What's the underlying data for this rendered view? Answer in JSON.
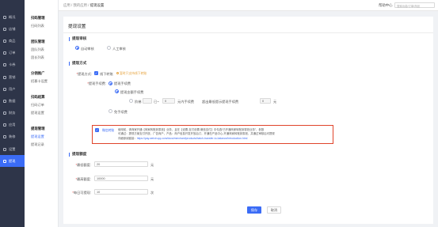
{
  "sidebar": {
    "items": [
      {
        "label": "概况"
      },
      {
        "label": "店铺"
      },
      {
        "label": "商品"
      },
      {
        "label": "订单"
      },
      {
        "label": "卡券"
      },
      {
        "label": "营销"
      },
      {
        "label": "用户"
      },
      {
        "label": "数据"
      },
      {
        "label": "财务"
      },
      {
        "label": "应用"
      },
      {
        "label": "装修"
      },
      {
        "label": "设置"
      },
      {
        "label": "提现"
      }
    ]
  },
  "subnav": {
    "groups": [
      {
        "title": "扫码管理",
        "links": [
          "扫码列表"
        ]
      },
      {
        "title": "团队管理",
        "links": [
          "团队列表",
          "团长列表"
        ]
      },
      {
        "title": "分佣推广",
        "links": [
          "招募卡设置"
        ]
      },
      {
        "title": "扫码结算",
        "links": [
          "扫码订单",
          "提现设置"
        ]
      },
      {
        "title": "提现管理",
        "links": [
          "提现设置",
          "提现记录"
        ]
      }
    ]
  },
  "topbar": {
    "breadcrumb": [
      "应用",
      "我的应用",
      "提现设置"
    ],
    "help": "帮助中心",
    "search_placeholder": "搜索功能/订单/商品"
  },
  "main": {
    "title": "提现设置",
    "audit": {
      "title": "提现审核",
      "options": [
        "自动审核",
        "人工审核"
      ]
    },
    "method": {
      "title": "提现方式",
      "label": "提现方式:",
      "checkbox_label": "线下转账",
      "hint": "暂时只支持线下转账",
      "fee_label": "提现手续费:",
      "fee_options": [
        "提现手续费",
        "免手续费"
      ],
      "fee_sub_options": [
        "提现金额手续费",
        "阶梯"
      ],
      "fee_row": [
        "已~",
        "0",
        "元内手续费",
        "超出最低提示提现手续费",
        "0",
        "元"
      ],
      "no_fee": "免手续费"
    },
    "notice": {
      "label": "微信转账",
      "line1": "使用前，请商家开通【商家转账到零钱】业务，且在【设置-支付设置-微信支付】中勾选“已开通商家转账到零钱业务”，参数",
      "line2": "可通过：提现方案支付开放，广告商户，产品：商户信息开发开放后订，开通在产品中心-开通商家转账到零钱，并通过审核后可提现",
      "line3": "详细参阅链接：",
      "link": "https://pay.weixin.qq.com/docs/merchant/products/batch-transfer-to-balance/introduction.html"
    },
    "amount": {
      "title": "提现额度",
      "fields": [
        {
          "label": "最低额度:",
          "value": "20",
          "unit": "元"
        },
        {
          "label": "最高额度:",
          "value": "10000",
          "unit": "元"
        },
        {
          "label": "每日可提现:",
          "value": "10",
          "unit": "次"
        }
      ]
    },
    "buttons": {
      "save": "保存",
      "cancel": "取消"
    }
  },
  "colors": {
    "accent": "#3b6cf6",
    "sidebar": "#2e3549",
    "notice_border": "#e0442b"
  }
}
